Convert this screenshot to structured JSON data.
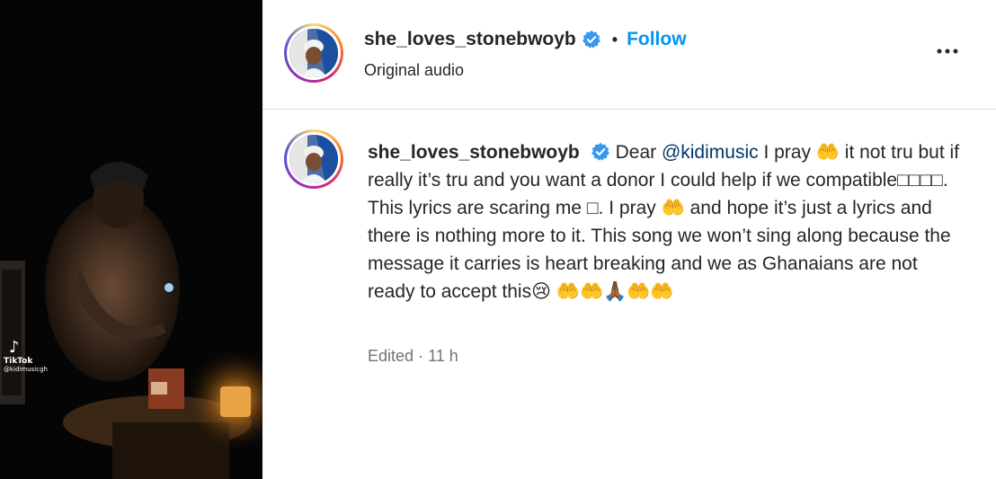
{
  "header": {
    "username": "she_loves_stonebwoyb",
    "separator": "•",
    "follow_label": "Follow",
    "subtitle": "Original audio"
  },
  "icons": {
    "verified": "verified-badge-icon",
    "more": "more-options-icon"
  },
  "comment": {
    "username": "she_loves_stonebwoyb",
    "text_before": "Dear ",
    "mention": "@kidimusic",
    "text_after": " I pray 🤲 it not tru but if really it’s tru and you want a donor I could help if we compatible□□□□. This lyrics are scaring me □. I pray 🤲 and hope it’s just a lyrics and there is nothing more to it. This song we won’t sing along because the message it carries is heart breaking and we as Ghanaians are not ready to accept this😢 🤲🤲🙏🏾🤲🤲",
    "edited": "Edited",
    "dot": "·",
    "time": "11 h"
  },
  "media": {
    "watermark_brand": "TikTok",
    "watermark_handle": "@kidimusicgh"
  },
  "colors": {
    "accent": "#0095f6",
    "mention": "#00376b",
    "verified": "#3897f0",
    "muted": "#737373"
  }
}
